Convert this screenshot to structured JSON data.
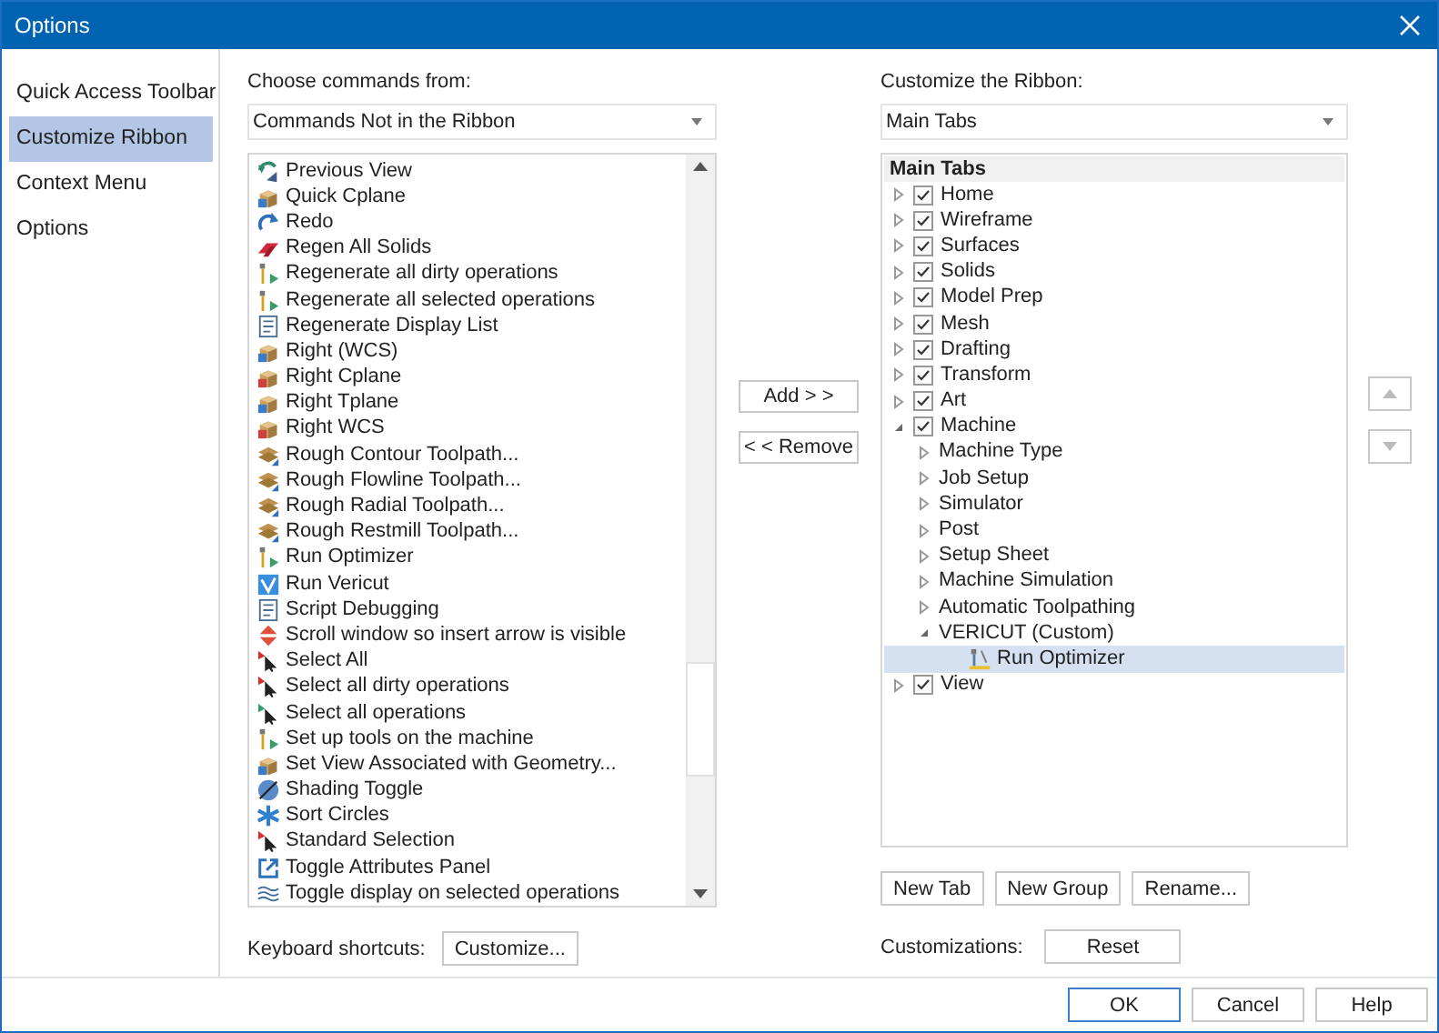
{
  "window": {
    "title": "Options"
  },
  "sidebar": {
    "items": [
      {
        "label": "Quick Access Toolbar",
        "selected": false
      },
      {
        "label": "Customize Ribbon",
        "selected": true
      },
      {
        "label": "Context Menu",
        "selected": false
      },
      {
        "label": "Options",
        "selected": false
      }
    ]
  },
  "commands_panel": {
    "label": "Choose commands from:",
    "dropdown": "Commands Not in the Ribbon",
    "commands": [
      {
        "label": "Previous View"
      },
      {
        "label": "Quick Cplane"
      },
      {
        "label": "Redo"
      },
      {
        "label": "Regen All Solids"
      },
      {
        "label": "Regenerate all dirty operations"
      },
      {
        "label": "Regenerate all selected operations"
      },
      {
        "label": "Regenerate Display List"
      },
      {
        "label": "Right (WCS)"
      },
      {
        "label": "Right Cplane"
      },
      {
        "label": "Right Tplane"
      },
      {
        "label": "Right WCS"
      },
      {
        "label": "Rough Contour Toolpath..."
      },
      {
        "label": "Rough Flowline Toolpath..."
      },
      {
        "label": "Rough Radial Toolpath..."
      },
      {
        "label": "Rough Restmill Toolpath..."
      },
      {
        "label": "Run Optimizer"
      },
      {
        "label": "Run Vericut"
      },
      {
        "label": "Script Debugging"
      },
      {
        "label": "Scroll window so insert arrow is visible"
      },
      {
        "label": "Select All"
      },
      {
        "label": "Select all dirty operations"
      },
      {
        "label": "Select all operations"
      },
      {
        "label": "Set up tools on the machine"
      },
      {
        "label": "Set View Associated with Geometry..."
      },
      {
        "label": "Shading Toggle"
      },
      {
        "label": "Sort Circles"
      },
      {
        "label": "Standard Selection"
      },
      {
        "label": "Toggle Attributes Panel"
      },
      {
        "label": "Toggle display on selected operations"
      }
    ]
  },
  "move_buttons": {
    "add": "Add > >",
    "remove": "< < Remove"
  },
  "ribbon_panel": {
    "label": "Customize the Ribbon:",
    "dropdown": "Main Tabs",
    "tree_header": "Main Tabs",
    "tree": [
      {
        "kind": "tab",
        "label": "Home",
        "checked": true,
        "expanded": false,
        "selected": false
      },
      {
        "kind": "tab",
        "label": "Wireframe",
        "checked": true,
        "expanded": false,
        "selected": false
      },
      {
        "kind": "tab",
        "label": "Surfaces",
        "checked": true,
        "expanded": false,
        "selected": false
      },
      {
        "kind": "tab",
        "label": "Solids",
        "checked": true,
        "expanded": false,
        "selected": false
      },
      {
        "kind": "tab",
        "label": "Model Prep",
        "checked": true,
        "expanded": false,
        "selected": false
      },
      {
        "kind": "tab",
        "label": "Mesh",
        "checked": true,
        "expanded": false,
        "selected": false
      },
      {
        "kind": "tab",
        "label": "Drafting",
        "checked": true,
        "expanded": false,
        "selected": false
      },
      {
        "kind": "tab",
        "label": "Transform",
        "checked": true,
        "expanded": false,
        "selected": false
      },
      {
        "kind": "tab",
        "label": "Art",
        "checked": true,
        "expanded": false,
        "selected": false
      },
      {
        "kind": "tab",
        "label": "Machine",
        "checked": true,
        "expanded": true,
        "selected": false,
        "children": [
          {
            "kind": "group",
            "label": "Machine Type",
            "expanded": false,
            "selected": false
          },
          {
            "kind": "group",
            "label": "Job Setup",
            "expanded": false,
            "selected": false
          },
          {
            "kind": "group",
            "label": "Simulator",
            "expanded": false,
            "selected": false
          },
          {
            "kind": "group",
            "label": "Post",
            "expanded": false,
            "selected": false
          },
          {
            "kind": "group",
            "label": "Setup Sheet",
            "expanded": false,
            "selected": false
          },
          {
            "kind": "group",
            "label": "Machine Simulation",
            "expanded": false,
            "selected": false
          },
          {
            "kind": "group",
            "label": "Automatic Toolpathing",
            "expanded": false,
            "selected": false
          },
          {
            "kind": "group",
            "label": "VERICUT (Custom)",
            "expanded": true,
            "selected": false,
            "children": [
              {
                "kind": "command",
                "label": "Run Optimizer",
                "selected": true
              }
            ]
          }
        ]
      },
      {
        "kind": "tab",
        "label": "View",
        "checked": true,
        "expanded": false,
        "selected": false
      }
    ]
  },
  "tree_buttons": [
    "New Tab",
    "New Group",
    "Rename..."
  ],
  "keyboard_shortcuts": {
    "label": "Keyboard shortcuts:",
    "button": "Customize..."
  },
  "customizations": {
    "label": "Customizations:",
    "button": "Reset"
  },
  "footer_buttons": [
    {
      "label": "OK",
      "default": true
    },
    {
      "label": "Cancel",
      "default": false
    },
    {
      "label": "Help",
      "default": false
    }
  ]
}
